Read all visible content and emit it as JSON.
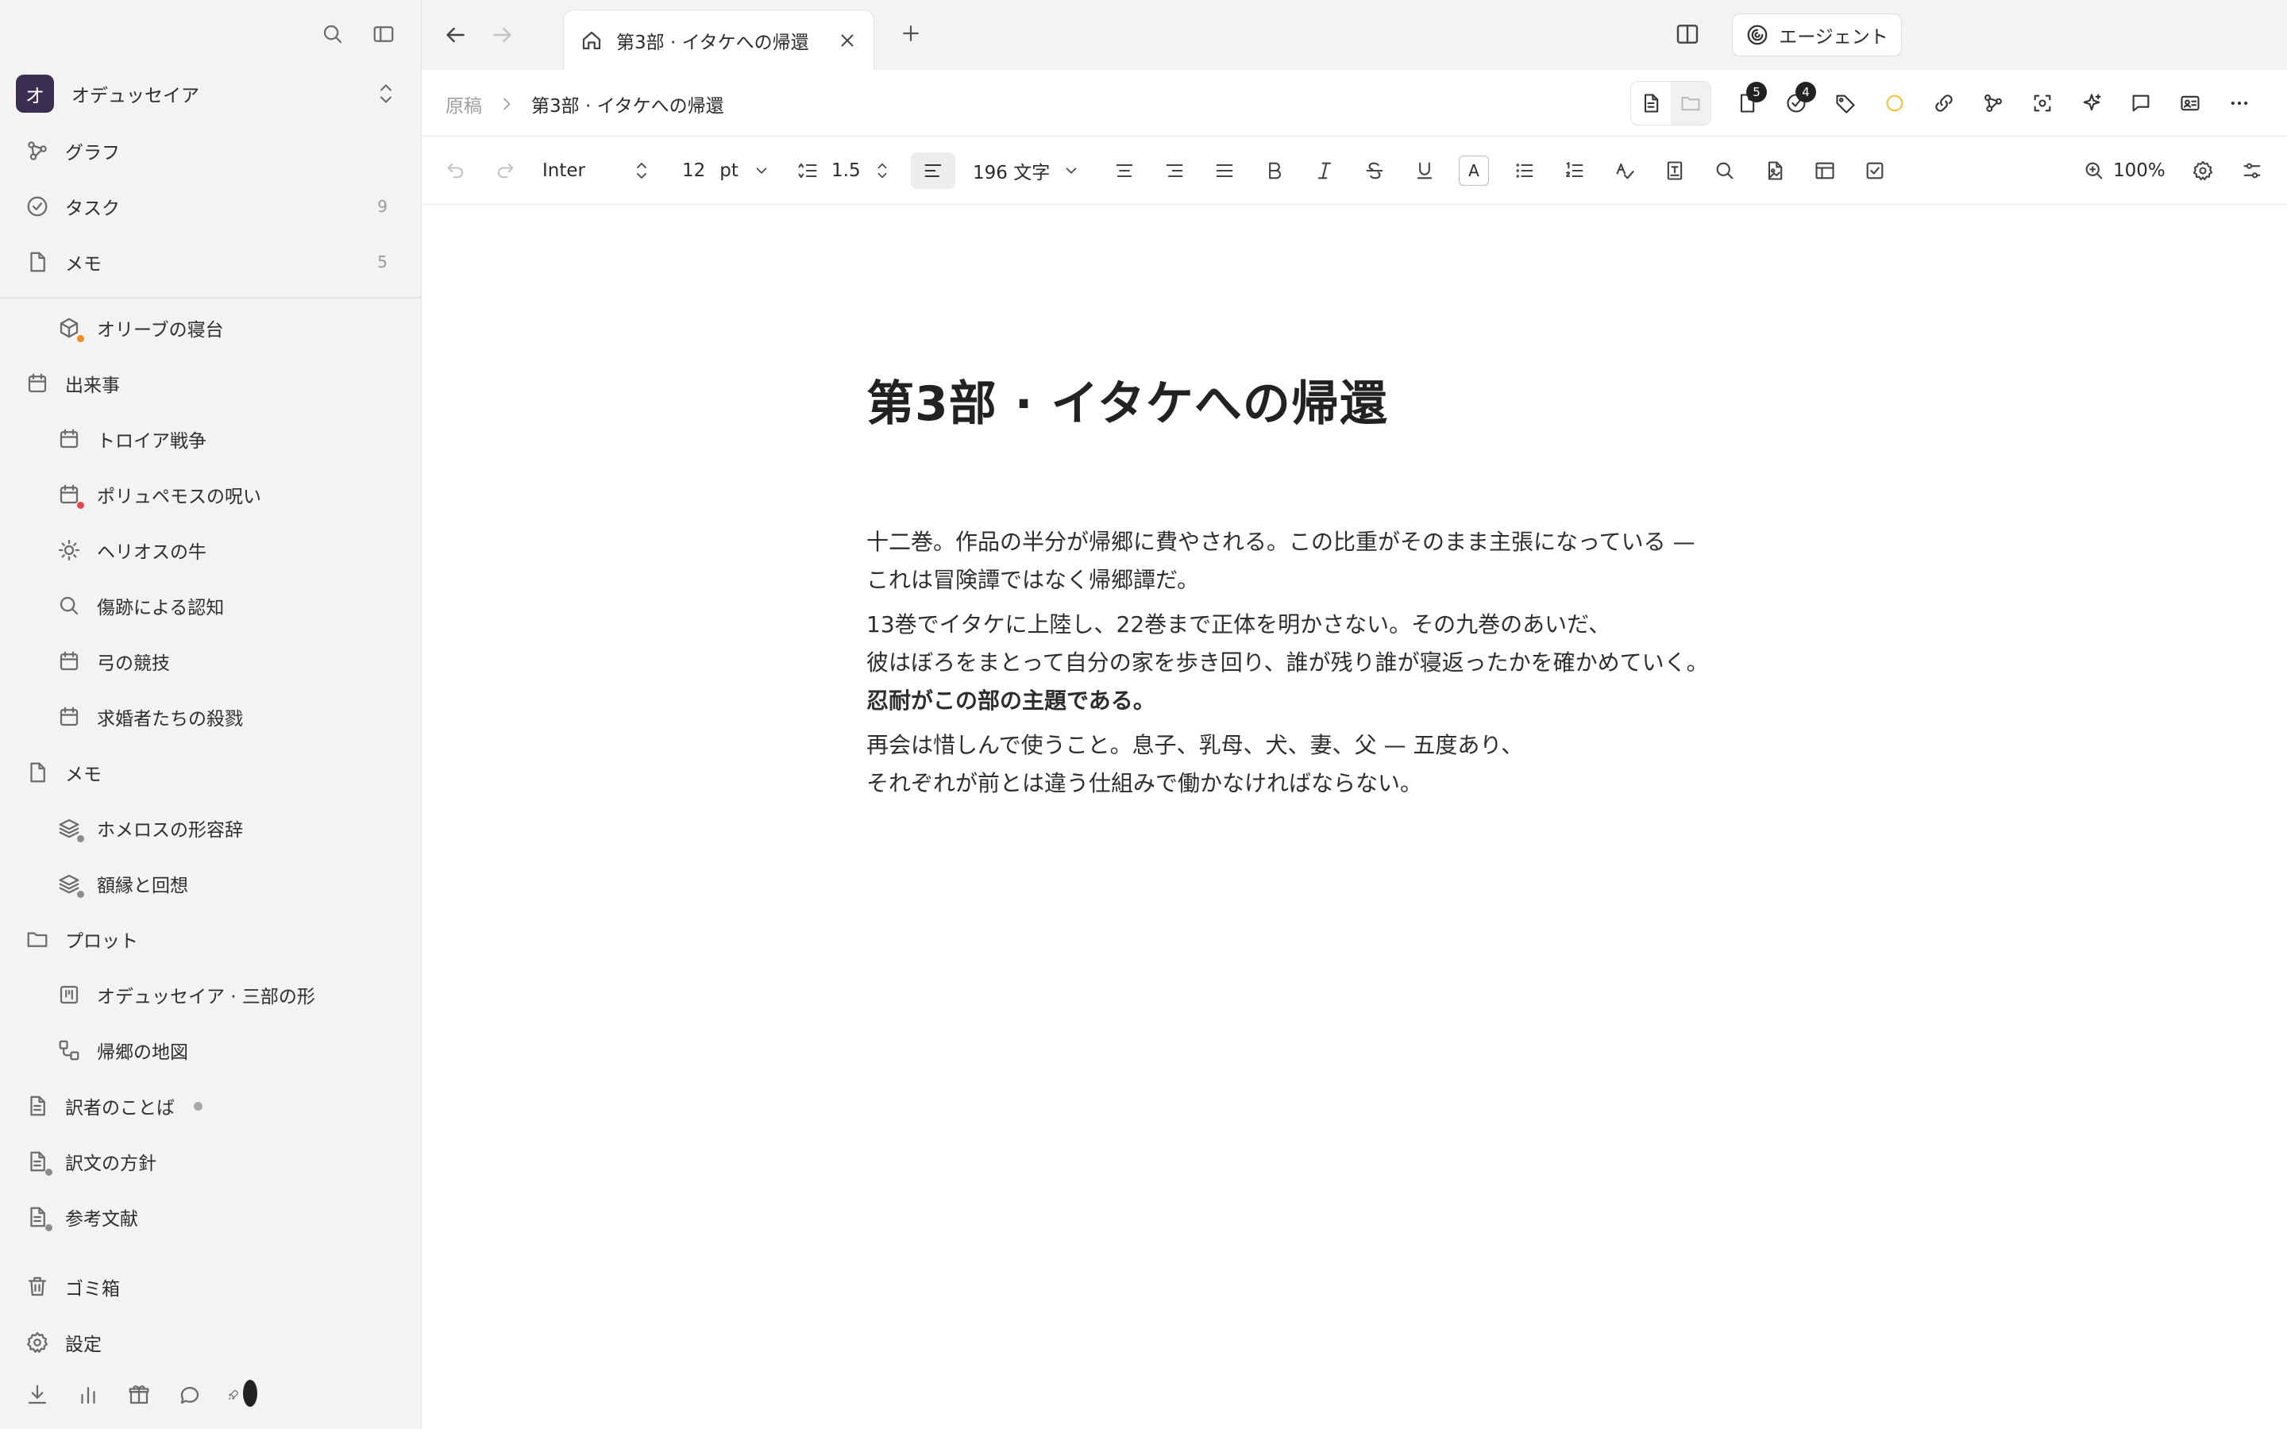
{
  "sidebar": {
    "workspace": {
      "initial": "オ",
      "name": "オデュッセイア"
    },
    "nav": [
      {
        "label": "グラフ",
        "count": ""
      },
      {
        "label": "タスク",
        "count": "9"
      },
      {
        "label": "メモ",
        "count": "5"
      }
    ],
    "tree": [
      {
        "label": "オリーブの寝台"
      },
      {
        "label": "出来事"
      },
      {
        "label": "トロイア戦争"
      },
      {
        "label": "ポリュペモスの呪い"
      },
      {
        "label": "ヘリオスの牛"
      },
      {
        "label": "傷跡による認知"
      },
      {
        "label": "弓の競技"
      },
      {
        "label": "求婚者たちの殺戮"
      },
      {
        "label": "メモ"
      },
      {
        "label": "ホメロスの形容辞"
      },
      {
        "label": "額縁と回想"
      },
      {
        "label": "プロット"
      },
      {
        "label": "オデュッセイア · 三部の形"
      },
      {
        "label": "帰郷の地図"
      },
      {
        "label": "訳者のことば"
      },
      {
        "label": "訳文の方針"
      },
      {
        "label": "参考文献"
      }
    ],
    "footer": [
      {
        "label": "ゴミ箱"
      },
      {
        "label": "設定"
      }
    ],
    "colors": {
      "orange_dot": "#f08a24",
      "red_dot": "#e5484d",
      "grey_dot": "#8c8c8c",
      "avatar": "#3a2f52"
    }
  },
  "tab": {
    "label": "第3部 · イタケへの帰還"
  },
  "agent": {
    "label": "エージェント"
  },
  "breadcrumb": {
    "parent": "原稿",
    "current": "第3部 · イタケへの帰還"
  },
  "header": {
    "badge_docs": "5",
    "badge_tasks": "4"
  },
  "toolbar": {
    "font": "Inter",
    "size": "12",
    "unit": "pt",
    "line_height": "1.5",
    "word_count": "196 文字",
    "color_glyph": "A",
    "zoom": "100%"
  },
  "document": {
    "title": "第3部 · イタケへの帰還",
    "lines": [
      "十二巻。作品の半分が帰郷に費やされる。この比重がそのまま主張になっている —",
      "これは冒険譚ではなく帰郷譚だ。",
      "13巻でイタケに上陸し、22巻まで正体を明かさない。その九巻のあいだ、",
      "彼はぼろをまとって自分の家を歩き回り、誰が残り誰が寝返ったかを確かめていく。",
      "忍耐がこの部の主題である。",
      "再会は惜しんで使うこと。息子、乳母、犬、妻、父 — 五度あり、",
      "それぞれが前とは違う仕組みで働かなければならない。"
    ]
  }
}
